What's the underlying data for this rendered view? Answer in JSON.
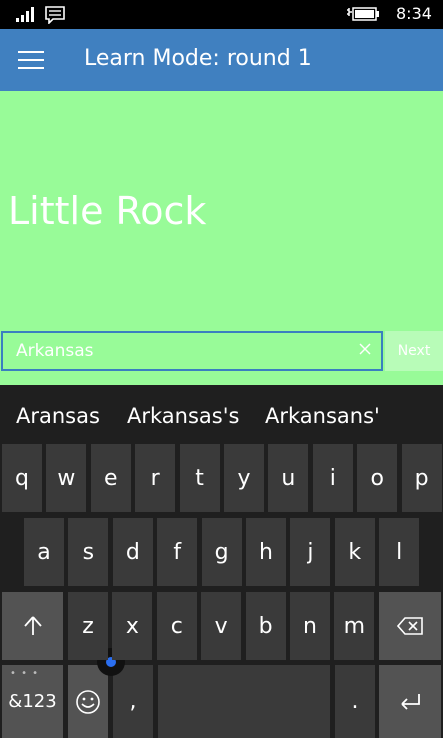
{
  "status_bar": {
    "time": "8:34"
  },
  "header": {
    "title": "Learn Mode: round 1"
  },
  "main": {
    "question": "Little Rock",
    "answer_value": "Arkansas",
    "next_label": "Next"
  },
  "keyboard": {
    "suggestions": [
      "Aransas",
      "Arkansas's",
      "Arkansans'"
    ],
    "row1": [
      "q",
      "w",
      "e",
      "r",
      "t",
      "y",
      "u",
      "i",
      "o",
      "p"
    ],
    "row2": [
      "a",
      "s",
      "d",
      "f",
      "g",
      "h",
      "j",
      "k",
      "l"
    ],
    "row3": [
      "z",
      "x",
      "c",
      "v",
      "b",
      "n",
      "m"
    ],
    "symbols_label": "&123",
    "comma_label": ",",
    "period_label": "."
  },
  "colors": {
    "header": "#4080c0",
    "main_bg": "#98fb98",
    "input_border": "#3a7fc0",
    "keyboard_bg": "#1f1f1f",
    "key": "#3a3a3a",
    "fn_key": "#535353"
  }
}
